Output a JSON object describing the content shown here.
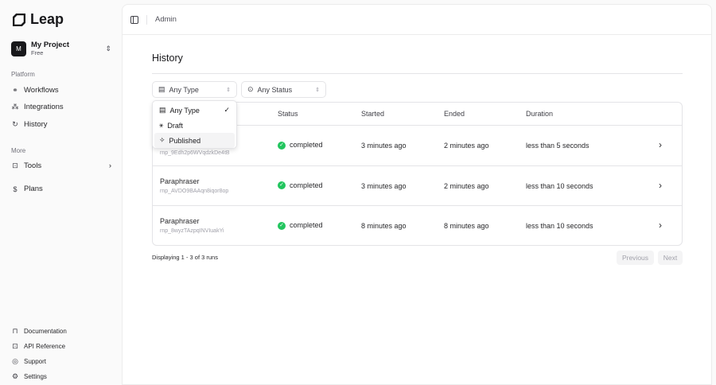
{
  "app": {
    "name": "Leap"
  },
  "project": {
    "initial": "M",
    "name": "My Project",
    "plan": "Free"
  },
  "sidebar": {
    "platform_label": "Platform",
    "platform": [
      {
        "label": "Workflows",
        "icon": "workflow-icon"
      },
      {
        "label": "Integrations",
        "icon": "integrations-icon"
      },
      {
        "label": "History",
        "icon": "history-icon"
      }
    ],
    "more_label": "More",
    "more": [
      {
        "label": "Tools",
        "icon": "terminal-icon"
      },
      {
        "label": "Plans",
        "icon": "dollar-icon"
      }
    ],
    "footer": [
      {
        "label": "Documentation",
        "icon": "book-icon"
      },
      {
        "label": "API Reference",
        "icon": "terminal-icon"
      },
      {
        "label": "Support",
        "icon": "lifebuoy-icon"
      },
      {
        "label": "Settings",
        "icon": "gear-icon"
      }
    ]
  },
  "header": {
    "breadcrumb": "Admin"
  },
  "page": {
    "title": "History"
  },
  "filters": {
    "type": "Any Type",
    "status": "Any Status"
  },
  "type_dropdown": {
    "options": [
      {
        "label": "Any Type",
        "selected": true
      },
      {
        "label": "Draft"
      },
      {
        "label": "Published",
        "highlighted": true
      }
    ]
  },
  "table": {
    "columns": [
      "Status",
      "Started",
      "Ended",
      "Duration"
    ],
    "rows": [
      {
        "name": "",
        "id": "rnp_9Edh2p6WVqdzkDe4tB",
        "status": "completed",
        "started": "3 minutes ago",
        "ended": "2 minutes ago",
        "duration": "less than 5 seconds"
      },
      {
        "name": "Paraphraser",
        "id": "rnp_AVDO9BAAqn8iqor8op",
        "status": "completed",
        "started": "3 minutes ago",
        "ended": "2 minutes ago",
        "duration": "less than 10 seconds"
      },
      {
        "name": "Paraphraser",
        "id": "rnp_8wyzTAzpqINVIuakYi",
        "status": "completed",
        "started": "8 minutes ago",
        "ended": "8 minutes ago",
        "duration": "less than 10 seconds"
      }
    ]
  },
  "pagination": {
    "summary": "Displaying 1 - 3 of 3 runs",
    "previous": "Previous",
    "next": "Next"
  },
  "colors": {
    "success": "#22c55e",
    "sidebar_bg": "#fafafa"
  }
}
